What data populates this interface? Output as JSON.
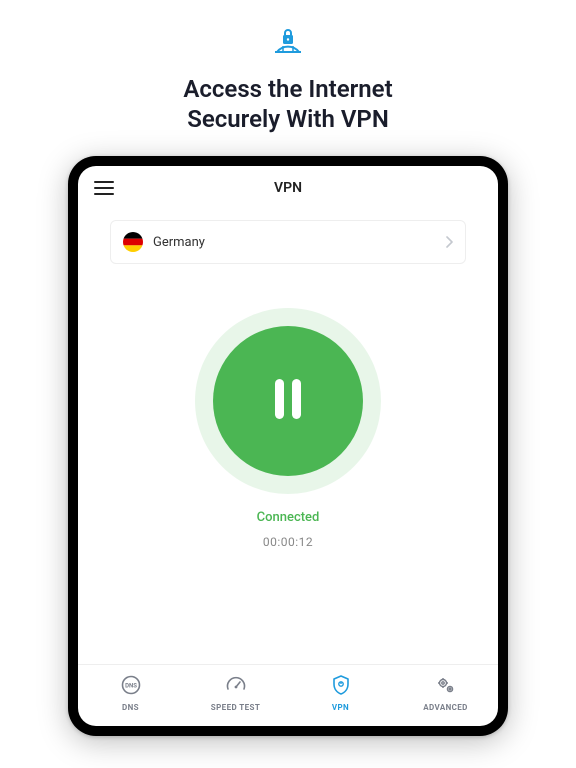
{
  "promo": {
    "line1": "Access the Internet",
    "line2": "Securely With VPN"
  },
  "header": {
    "title": "VPN"
  },
  "country": {
    "name": "Germany"
  },
  "status": {
    "label": "Connected",
    "timer": "00:00:12"
  },
  "tabs": {
    "dns": "DNS",
    "speed": "SPEED TEST",
    "vpn": "VPN",
    "advanced": "ADVANCED"
  },
  "colors": {
    "accent": "#1f9bdd",
    "success": "#4bb653"
  }
}
